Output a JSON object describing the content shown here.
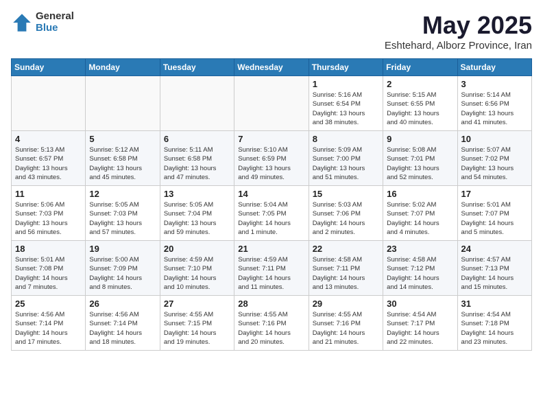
{
  "logo": {
    "general": "General",
    "blue": "Blue"
  },
  "title": {
    "month_year": "May 2025",
    "location": "Eshtehard, Alborz Province, Iran"
  },
  "headers": [
    "Sunday",
    "Monday",
    "Tuesday",
    "Wednesday",
    "Thursday",
    "Friday",
    "Saturday"
  ],
  "weeks": [
    [
      {
        "day": "",
        "content": ""
      },
      {
        "day": "",
        "content": ""
      },
      {
        "day": "",
        "content": ""
      },
      {
        "day": "",
        "content": ""
      },
      {
        "day": "1",
        "content": "Sunrise: 5:16 AM\nSunset: 6:54 PM\nDaylight: 13 hours\nand 38 minutes."
      },
      {
        "day": "2",
        "content": "Sunrise: 5:15 AM\nSunset: 6:55 PM\nDaylight: 13 hours\nand 40 minutes."
      },
      {
        "day": "3",
        "content": "Sunrise: 5:14 AM\nSunset: 6:56 PM\nDaylight: 13 hours\nand 41 minutes."
      }
    ],
    [
      {
        "day": "4",
        "content": "Sunrise: 5:13 AM\nSunset: 6:57 PM\nDaylight: 13 hours\nand 43 minutes."
      },
      {
        "day": "5",
        "content": "Sunrise: 5:12 AM\nSunset: 6:58 PM\nDaylight: 13 hours\nand 45 minutes."
      },
      {
        "day": "6",
        "content": "Sunrise: 5:11 AM\nSunset: 6:58 PM\nDaylight: 13 hours\nand 47 minutes."
      },
      {
        "day": "7",
        "content": "Sunrise: 5:10 AM\nSunset: 6:59 PM\nDaylight: 13 hours\nand 49 minutes."
      },
      {
        "day": "8",
        "content": "Sunrise: 5:09 AM\nSunset: 7:00 PM\nDaylight: 13 hours\nand 51 minutes."
      },
      {
        "day": "9",
        "content": "Sunrise: 5:08 AM\nSunset: 7:01 PM\nDaylight: 13 hours\nand 52 minutes."
      },
      {
        "day": "10",
        "content": "Sunrise: 5:07 AM\nSunset: 7:02 PM\nDaylight: 13 hours\nand 54 minutes."
      }
    ],
    [
      {
        "day": "11",
        "content": "Sunrise: 5:06 AM\nSunset: 7:03 PM\nDaylight: 13 hours\nand 56 minutes."
      },
      {
        "day": "12",
        "content": "Sunrise: 5:05 AM\nSunset: 7:03 PM\nDaylight: 13 hours\nand 57 minutes."
      },
      {
        "day": "13",
        "content": "Sunrise: 5:05 AM\nSunset: 7:04 PM\nDaylight: 13 hours\nand 59 minutes."
      },
      {
        "day": "14",
        "content": "Sunrise: 5:04 AM\nSunset: 7:05 PM\nDaylight: 14 hours\nand 1 minute."
      },
      {
        "day": "15",
        "content": "Sunrise: 5:03 AM\nSunset: 7:06 PM\nDaylight: 14 hours\nand 2 minutes."
      },
      {
        "day": "16",
        "content": "Sunrise: 5:02 AM\nSunset: 7:07 PM\nDaylight: 14 hours\nand 4 minutes."
      },
      {
        "day": "17",
        "content": "Sunrise: 5:01 AM\nSunset: 7:07 PM\nDaylight: 14 hours\nand 5 minutes."
      }
    ],
    [
      {
        "day": "18",
        "content": "Sunrise: 5:01 AM\nSunset: 7:08 PM\nDaylight: 14 hours\nand 7 minutes."
      },
      {
        "day": "19",
        "content": "Sunrise: 5:00 AM\nSunset: 7:09 PM\nDaylight: 14 hours\nand 8 minutes."
      },
      {
        "day": "20",
        "content": "Sunrise: 4:59 AM\nSunset: 7:10 PM\nDaylight: 14 hours\nand 10 minutes."
      },
      {
        "day": "21",
        "content": "Sunrise: 4:59 AM\nSunset: 7:11 PM\nDaylight: 14 hours\nand 11 minutes."
      },
      {
        "day": "22",
        "content": "Sunrise: 4:58 AM\nSunset: 7:11 PM\nDaylight: 14 hours\nand 13 minutes."
      },
      {
        "day": "23",
        "content": "Sunrise: 4:58 AM\nSunset: 7:12 PM\nDaylight: 14 hours\nand 14 minutes."
      },
      {
        "day": "24",
        "content": "Sunrise: 4:57 AM\nSunset: 7:13 PM\nDaylight: 14 hours\nand 15 minutes."
      }
    ],
    [
      {
        "day": "25",
        "content": "Sunrise: 4:56 AM\nSunset: 7:14 PM\nDaylight: 14 hours\nand 17 minutes."
      },
      {
        "day": "26",
        "content": "Sunrise: 4:56 AM\nSunset: 7:14 PM\nDaylight: 14 hours\nand 18 minutes."
      },
      {
        "day": "27",
        "content": "Sunrise: 4:55 AM\nSunset: 7:15 PM\nDaylight: 14 hours\nand 19 minutes."
      },
      {
        "day": "28",
        "content": "Sunrise: 4:55 AM\nSunset: 7:16 PM\nDaylight: 14 hours\nand 20 minutes."
      },
      {
        "day": "29",
        "content": "Sunrise: 4:55 AM\nSunset: 7:16 PM\nDaylight: 14 hours\nand 21 minutes."
      },
      {
        "day": "30",
        "content": "Sunrise: 4:54 AM\nSunset: 7:17 PM\nDaylight: 14 hours\nand 22 minutes."
      },
      {
        "day": "31",
        "content": "Sunrise: 4:54 AM\nSunset: 7:18 PM\nDaylight: 14 hours\nand 23 minutes."
      }
    ]
  ]
}
